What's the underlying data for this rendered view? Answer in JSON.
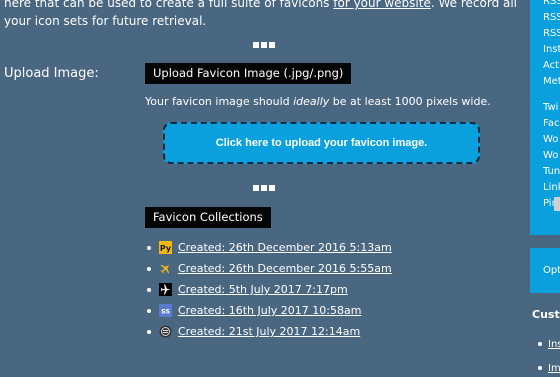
{
  "intro": {
    "text_before_link": "here that can be used to create a full suite of favicons ",
    "link": "for your website",
    "text_after_link": ". We record all your icon sets for future retrieval."
  },
  "upload": {
    "label": "Upload Image:",
    "section_title": "Upload Favicon Image (.jpg/.png)",
    "hint_before": "Your favicon image should ",
    "hint_em": "ideally",
    "hint_after": " be at least 1000 pixels wide.",
    "button_label": "Click here to upload your favicon image."
  },
  "collections": {
    "title": "Favicon Collections",
    "items": [
      {
        "label": "Created: 26th December 2016 5:13am",
        "icon": "py-logo-icon",
        "icon_color": "#f5b80c"
      },
      {
        "label": "Created: 26th December 2016 5:55am",
        "icon": "airplane-icon",
        "icon_color": "#f5b80c"
      },
      {
        "label": "Created: 5th July 2017 7:17pm",
        "icon": "airplane-black-icon",
        "icon_color": "#000000"
      },
      {
        "label": "Created: 16th July 2017 10:58am",
        "icon": "ss-logo-icon",
        "icon_color": "#5a7ad0"
      },
      {
        "label": "Created: 21st July 2017 12:14am",
        "icon": "round-logo-icon",
        "icon_color": "#333333"
      }
    ]
  },
  "sidebar": {
    "top_items": [
      "RSS",
      "RSS",
      "RSS",
      "Inst",
      "Acti",
      "Met"
    ],
    "mid_items": [
      "Twi",
      "Fac",
      "Wo",
      "Wo",
      "Tun",
      "Link",
      "Pint"
    ],
    "options_label": "Opt",
    "heading": "Custo",
    "links": [
      "Ins",
      "Im"
    ]
  },
  "colors": {
    "page_bg": "#4a6782",
    "accent": "#0a9fdd"
  }
}
